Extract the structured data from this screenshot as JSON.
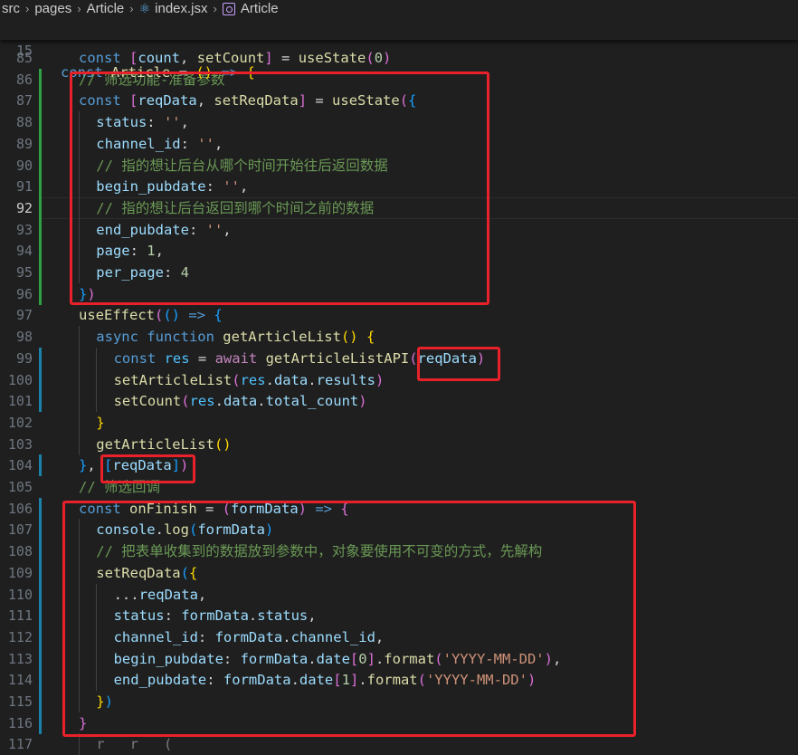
{
  "breadcrumb": {
    "items": [
      "src",
      "pages",
      "Article",
      "index.jsx",
      "Article"
    ]
  },
  "sticky_line": {
    "number": "15"
  },
  "editor": {
    "lines": [
      {
        "n": "85"
      },
      {
        "n": "86"
      },
      {
        "n": "87"
      },
      {
        "n": "88"
      },
      {
        "n": "89"
      },
      {
        "n": "90"
      },
      {
        "n": "91"
      },
      {
        "n": "92"
      },
      {
        "n": "93"
      },
      {
        "n": "94"
      },
      {
        "n": "95"
      },
      {
        "n": "96"
      },
      {
        "n": "97"
      },
      {
        "n": "98"
      },
      {
        "n": "99"
      },
      {
        "n": "100"
      },
      {
        "n": "101"
      },
      {
        "n": "102"
      },
      {
        "n": "103"
      },
      {
        "n": "104"
      },
      {
        "n": "105"
      },
      {
        "n": "106"
      },
      {
        "n": "107"
      },
      {
        "n": "108"
      },
      {
        "n": "109"
      },
      {
        "n": "110"
      },
      {
        "n": "111"
      },
      {
        "n": "112"
      },
      {
        "n": "113"
      },
      {
        "n": "114"
      },
      {
        "n": "115"
      },
      {
        "n": "116"
      },
      {
        "n": "117"
      }
    ],
    "active_line": "92"
  },
  "code": {
    "l15": {
      "const": "const",
      "name": "Article",
      "eq": " = ",
      "p": "()",
      "arrow": " => ",
      "b": "{"
    },
    "l85": {
      "kw": "const",
      "b1": "[",
      "a": "count",
      "comma": ", ",
      "b2": "setCount",
      "b3": "]",
      "eq": " = ",
      "fn": "useState",
      "p1": "(",
      "v": "0",
      "p2": ")"
    },
    "l86": "// 筛选功能-准备参数",
    "l87": {
      "kw": "const",
      "b1": "[",
      "a": "reqData",
      "comma": ", ",
      "b2": "setReqData",
      "b3": "]",
      "eq": " = ",
      "fn": "useState",
      "p1": "(",
      "b": "{"
    },
    "l88": {
      "k": "status",
      "c": ": ",
      "s": "''",
      "t": ","
    },
    "l89": {
      "k": "channel_id",
      "c": ": ",
      "s": "''",
      "t": ","
    },
    "l90": "// 指的想让后台从哪个时间开始往后返回数据",
    "l91": {
      "k": "begin_pubdate",
      "c": ": ",
      "s": "''",
      "t": ","
    },
    "l92": "// 指的想让后台返回到哪个时间之前的数据",
    "l93": {
      "k": "end_pubdate",
      "c": ": ",
      "s": "''",
      "t": ","
    },
    "l94": {
      "k": "page",
      "c": ": ",
      "s": "1",
      "t": ","
    },
    "l95": {
      "k": "per_page",
      "c": ": ",
      "s": "4"
    },
    "l96": {
      "b": "}",
      "p": ")"
    },
    "l97": {
      "fn": "useEffect",
      "p1": "(",
      "p2": "()",
      "arrow": " => ",
      "b": "{"
    },
    "l98": {
      "a": "async",
      "f": " function ",
      "fn": "getArticleList",
      "p": "()",
      "sp": " ",
      "b": "{"
    },
    "l99": {
      "kw": "const",
      "v": " res",
      "eq": " = ",
      "aw": "await ",
      "fn": "getArticleListAPI",
      "p1": "(",
      "arg": "reqData",
      "p2": ")"
    },
    "l100": {
      "fn": "setArticleList",
      "p1": "(",
      "a": "res",
      "d1": ".",
      "b": "data",
      "d2": ".",
      "c": "results",
      "p2": ")"
    },
    "l101": {
      "fn": "setCount",
      "p1": "(",
      "a": "res",
      "d1": ".",
      "b": "data",
      "d2": ".",
      "c": "total_count",
      "p2": ")"
    },
    "l102": {
      "b": "}"
    },
    "l103": {
      "fn": "getArticleList",
      "p": "()"
    },
    "l104": {
      "b": "}",
      "comma": ", ",
      "a1": "[",
      "v": "reqData",
      "a2": "]",
      "p": ")"
    },
    "l105": "// 筛选回调",
    "l106": {
      "kw": "const",
      "v": " onFinish",
      "eq": " = ",
      "p1": "(",
      "arg": "formData",
      "p2": ")",
      "arrow": " => ",
      "b": "{"
    },
    "l107": {
      "o": "console",
      "d": ".",
      "fn": "log",
      "p1": "(",
      "arg": "formData",
      "p2": ")"
    },
    "l108": "// 把表单收集到的数据放到参数中，对象要使用不可变的方式，先解构",
    "l109": {
      "fn": "setReqData",
      "p1": "(",
      "b": "{"
    },
    "l110": {
      "sp": "...",
      "v": "reqData",
      "c": ","
    },
    "l111": {
      "k": "status",
      "c": ": ",
      "o": "formData",
      "d": ".",
      "p": "status",
      "t": ","
    },
    "l112": {
      "k": "channel_id",
      "c": ": ",
      "o": "formData",
      "d": ".",
      "p": "channel_id",
      "t": ","
    },
    "l113": {
      "k": "begin_pubdate",
      "c": ": ",
      "o": "formData",
      "d": ".",
      "p": "date",
      "b1": "[",
      "i": "0",
      "b2": "]",
      "d2": ".",
      "fn": "format",
      "p1": "(",
      "s": "'YYYY-MM-DD'",
      "p2": ")",
      "t": ","
    },
    "l114": {
      "k": "end_pubdate",
      "c": ": ",
      "o": "formData",
      "d": ".",
      "p": "date",
      "b1": "[",
      "i": "1",
      "b2": "]",
      "d2": ".",
      "fn": "format",
      "p1": "(",
      "s": "'YYYY-MM-DD'",
      "p2": ")"
    },
    "l115": {
      "b": "}",
      "p": ")"
    },
    "l116": {
      "b": "}"
    },
    "l117": {
      "partial": "r   r   ("
    }
  },
  "colors": {
    "background": "#1f1f1f",
    "annotation_box": "#e8212a",
    "git_added": "#2ea043",
    "git_modified": "#1b81a8"
  }
}
